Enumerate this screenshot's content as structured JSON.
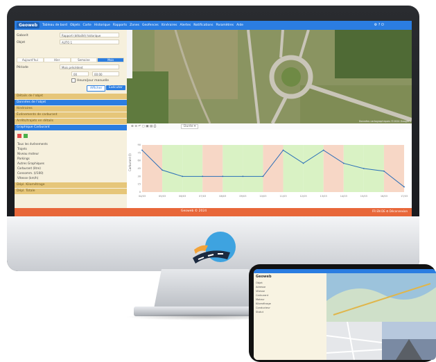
{
  "app": {
    "logo": "Geoweb",
    "nav_items": [
      "Tableau de bord",
      "Objets",
      "Carte",
      "Historique",
      "Rapports",
      "Zones",
      "Geofences",
      "Itinéraires",
      "Alertes",
      "Notifications",
      "Paramètres",
      "Aide"
    ],
    "nav_right": "⚙ ? ⏻"
  },
  "sidebar": {
    "fields": [
      {
        "label": "Gabarit",
        "value": "Rapport (détaillé) historique",
        "top": 4
      },
      {
        "label": "Objet",
        "value": "AUTO 1",
        "top": 14
      }
    ],
    "tabs": [
      {
        "label": "Aujourd'hui",
        "active": false
      },
      {
        "label": "Hier",
        "active": false
      },
      {
        "label": "Semaine",
        "active": false
      },
      {
        "label": "Mois",
        "active": true
      }
    ],
    "period_label": "Période",
    "period_value": "Mois précédent",
    "time_from": "00",
    "time_to": "00:00",
    "checkbox_label": "Heure/jour manuelle",
    "btn_show": "Afficher",
    "btn_run": "Exécuter",
    "sections": [
      {
        "label": "Détails de l'objet",
        "style": "gold"
      },
      {
        "label": "Données de l'objet",
        "style": "blue"
      },
      {
        "label": "Itinéraires",
        "style": "gold"
      },
      {
        "label": "Événements de carburant",
        "style": "gold"
      },
      {
        "label": "Arrêts/trajets en détails",
        "style": "gold"
      },
      {
        "label": "Graphique Carburant",
        "style": "blue"
      }
    ],
    "legend": [
      "Tous les événements",
      "Trajets",
      "Niveau moteur",
      "Parkings",
      "Autres Graphiques",
      "Carburant (litre)",
      "Consomm. (l/100)",
      "Vitesse (km/h)"
    ],
    "lower_sections": [
      "Dépl. Kilométrage",
      "Dépl. Totale"
    ]
  },
  "map_credit": "Données cartographiques ©2024 Google",
  "toolbar": {
    "items": "⊕ ⊖ ↶ ▢ ▣ ▤ ⎙",
    "select": "Durée ▾"
  },
  "chart": {
    "ylabel": "Carburant (l)"
  },
  "chart_data": {
    "type": "line",
    "title": "",
    "xlabel": "",
    "ylabel": "",
    "x": [
      "04/03",
      "05/03",
      "06/03",
      "07/03",
      "08/03",
      "09/03",
      "10/03",
      "11/03",
      "12/03",
      "13/03",
      "14/03",
      "15/03",
      "16/03",
      "17/03"
    ],
    "ylim": [
      0,
      90
    ],
    "series": [
      {
        "name": "Carburant",
        "values": [
          80,
          42,
          30,
          30,
          30,
          30,
          30,
          80,
          55,
          80,
          55,
          45,
          40,
          10
        ]
      }
    ]
  },
  "footer": {
    "center": "Geoweb © 2024",
    "right": "FR  EN  DE  ⚙ Déconnexion"
  },
  "phone": {
    "header": "Geoweb",
    "rows": [
      "Objet",
      "Adresse",
      "Vitesse",
      "Carburant",
      "Moteur",
      "Kilométrage",
      "Conducteur",
      "Statut"
    ]
  }
}
